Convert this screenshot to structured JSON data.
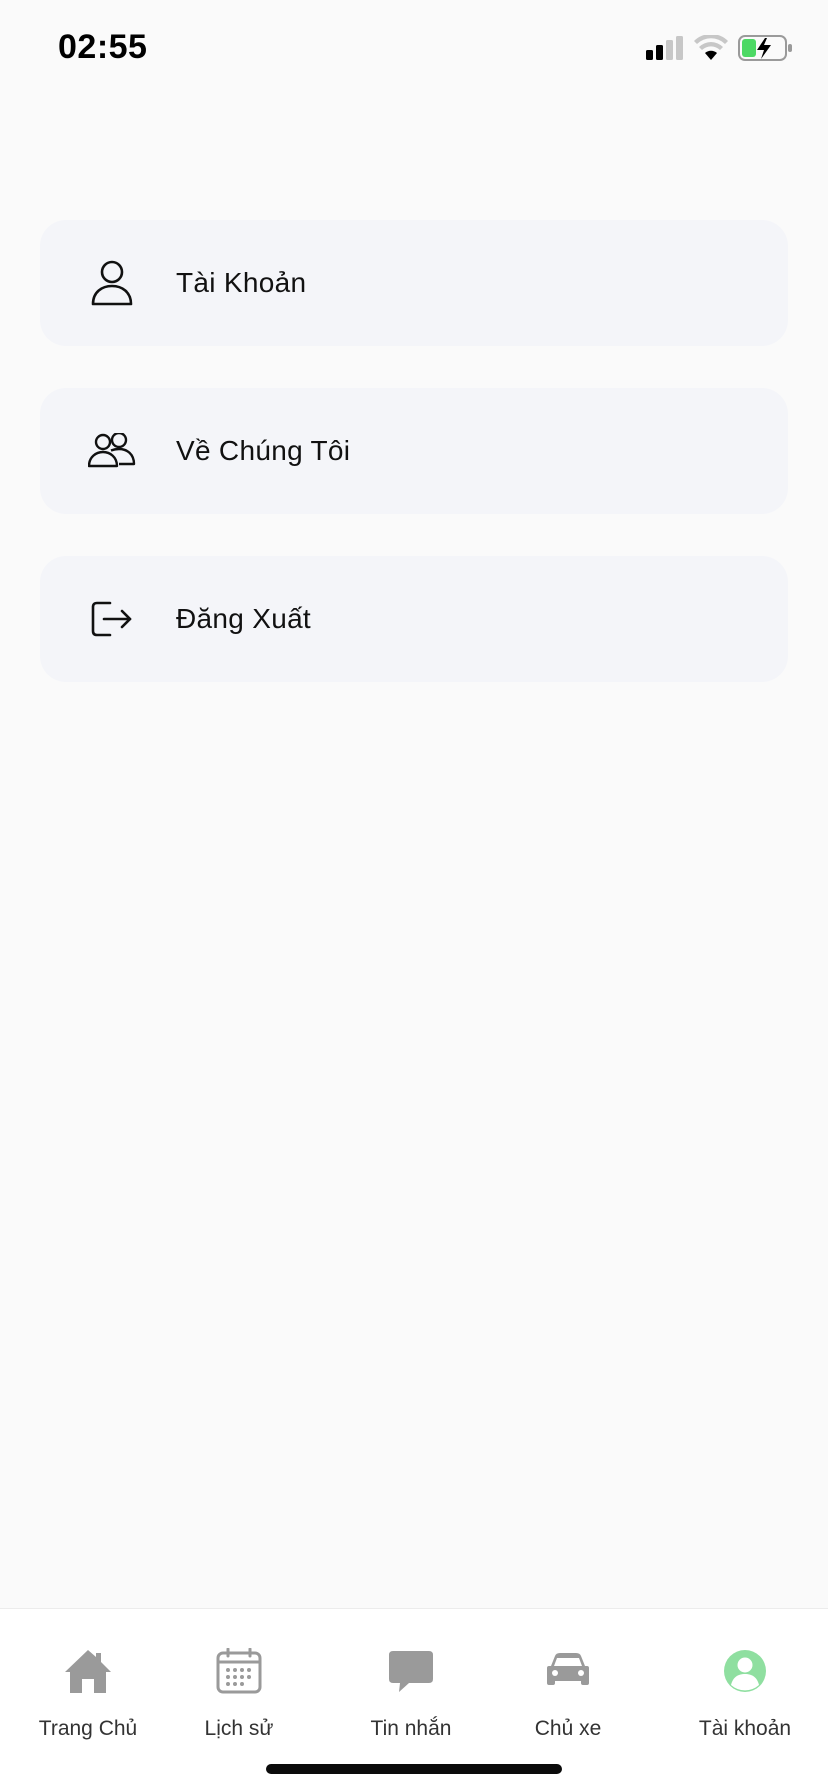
{
  "status_bar": {
    "time": "02:55",
    "icons": [
      "cellular-signal-icon",
      "wifi-icon",
      "battery-charging-icon"
    ],
    "battery_color": "#4cd964"
  },
  "menu": {
    "items": [
      {
        "label": "Tài Khoản",
        "icon": "person-icon"
      },
      {
        "label": "Về Chúng Tôi",
        "icon": "group-icon"
      },
      {
        "label": "Đăng Xuất",
        "icon": "logout-icon"
      }
    ]
  },
  "tab_bar": {
    "active_color": "#8fdfa0",
    "inactive_color": "#9a9a9a",
    "tabs": [
      {
        "label": "Trang Chủ",
        "icon": "home-icon",
        "active": false
      },
      {
        "label": "Lịch sử",
        "icon": "calendar-icon",
        "active": false
      },
      {
        "label": "Tin nhắn",
        "icon": "chat-bubble-icon",
        "active": false
      },
      {
        "label": "Chủ xe",
        "icon": "car-icon",
        "active": false
      },
      {
        "label": "Tài khoản",
        "icon": "account-circle-icon",
        "active": true
      }
    ]
  }
}
